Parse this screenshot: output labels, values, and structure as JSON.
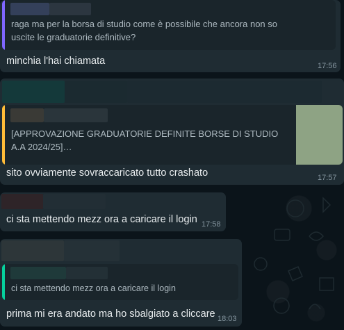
{
  "messages": [
    {
      "quote_text": "raga ma per la borsa di studio come è possibile che ancora non so uscite le graduatorie definitive?",
      "text": "minchia l'hai chiamata",
      "time": "17:56",
      "quote_color": "#7f66ff"
    },
    {
      "quote_text": "[APPROVAZIONE GRADUATORIE DEFINITE BORSE DI STUDIO A.A 2024/25]…",
      "text": "sito ovviamente sovraccaricato tutto crashato",
      "time": "17:57",
      "quote_color": "#ffbc38"
    },
    {
      "text": "ci sta mettendo mezz ora a caricare il login",
      "time": "17:58"
    },
    {
      "quote_text": "ci sta mettendo mezz ora a caricare il login",
      "text": "prima mi era andato ma ho sbalgiato a cliccare",
      "time": "18:03",
      "quote_color": "#06cf9c"
    }
  ],
  "colors": {
    "bubble": "#1f2c33",
    "background": "#0b141a",
    "thumbnail": "#8ea384"
  }
}
